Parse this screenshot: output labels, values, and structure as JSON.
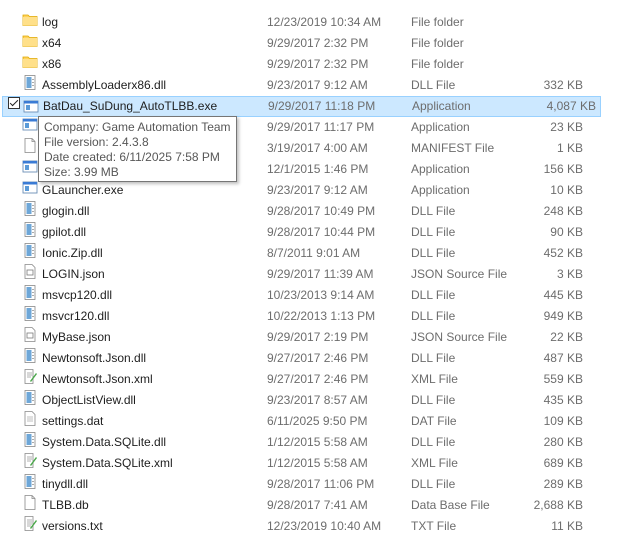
{
  "files": [
    {
      "name": "log",
      "date": "12/23/2019 10:34 AM",
      "type": "File folder",
      "size": "",
      "icon": "folder-icon"
    },
    {
      "name": "x64",
      "date": "9/29/2017 2:32 PM",
      "type": "File folder",
      "size": "",
      "icon": "folder-icon"
    },
    {
      "name": "x86",
      "date": "9/29/2017 2:32 PM",
      "type": "File folder",
      "size": "",
      "icon": "folder-icon"
    },
    {
      "name": "AssemblyLoaderx86.dll",
      "date": "9/23/2017 9:12 AM",
      "type": "DLL File",
      "size": "332 KB",
      "icon": "dll-icon"
    },
    {
      "name": "BatDau_SuDung_AutoTLBB.exe",
      "date": "9/29/2017 11:18 PM",
      "type": "Application",
      "size": "4,087 KB",
      "icon": "exe-icon",
      "selected": true
    },
    {
      "name": "",
      "date": "9/29/2017 11:17 PM",
      "type": "Application",
      "size": "23 KB",
      "icon": "exe-icon"
    },
    {
      "name": "st",
      "date": "3/19/2017 4:00 AM",
      "type": "MANIFEST File",
      "size": "1 KB",
      "icon": "generic-file-icon"
    },
    {
      "name": "",
      "date": "12/1/2015 1:46 PM",
      "type": "Application",
      "size": "156 KB",
      "icon": "exe-icon"
    },
    {
      "name": "GLauncher.exe",
      "date": "9/23/2017 9:12 AM",
      "type": "Application",
      "size": "10 KB",
      "icon": "exe-icon"
    },
    {
      "name": "glogin.dll",
      "date": "9/28/2017 10:49 PM",
      "type": "DLL File",
      "size": "248 KB",
      "icon": "dll-icon"
    },
    {
      "name": "gpilot.dll",
      "date": "9/28/2017 10:44 PM",
      "type": "DLL File",
      "size": "90 KB",
      "icon": "dll-icon"
    },
    {
      "name": "Ionic.Zip.dll",
      "date": "8/7/2011 9:01 AM",
      "type": "DLL File",
      "size": "452 KB",
      "icon": "dll-icon"
    },
    {
      "name": "LOGIN.json",
      "date": "9/29/2017 11:39 AM",
      "type": "JSON Source File",
      "size": "3 KB",
      "icon": "json-icon"
    },
    {
      "name": "msvcp120.dll",
      "date": "10/23/2013 9:14 AM",
      "type": "DLL File",
      "size": "445 KB",
      "icon": "dll-icon"
    },
    {
      "name": "msvcr120.dll",
      "date": "10/22/2013 1:13 PM",
      "type": "DLL File",
      "size": "949 KB",
      "icon": "dll-icon"
    },
    {
      "name": "MyBase.json",
      "date": "9/29/2017 2:19 PM",
      "type": "JSON Source File",
      "size": "22 KB",
      "icon": "json-icon"
    },
    {
      "name": "Newtonsoft.Json.dll",
      "date": "9/27/2017 2:46 PM",
      "type": "DLL File",
      "size": "487 KB",
      "icon": "dll-icon"
    },
    {
      "name": "Newtonsoft.Json.xml",
      "date": "9/27/2017 2:46 PM",
      "type": "XML File",
      "size": "559 KB",
      "icon": "xml-icon"
    },
    {
      "name": "ObjectListView.dll",
      "date": "9/23/2017 8:57 AM",
      "type": "DLL File",
      "size": "435 KB",
      "icon": "dll-icon"
    },
    {
      "name": "settings.dat",
      "date": "6/11/2025 9:50 PM",
      "type": "DAT File",
      "size": "109 KB",
      "icon": "dat-icon"
    },
    {
      "name": "System.Data.SQLite.dll",
      "date": "1/12/2015 5:58 AM",
      "type": "DLL File",
      "size": "280 KB",
      "icon": "dll-icon"
    },
    {
      "name": "System.Data.SQLite.xml",
      "date": "1/12/2015 5:58 AM",
      "type": "XML File",
      "size": "689 KB",
      "icon": "xml-icon"
    },
    {
      "name": "tinydll.dll",
      "date": "9/28/2017 11:06 PM",
      "type": "DLL File",
      "size": "289 KB",
      "icon": "dll-icon"
    },
    {
      "name": "TLBB.db",
      "date": "9/28/2017 7:41 AM",
      "type": "Data Base File",
      "size": "2,688 KB",
      "icon": "db-icon"
    },
    {
      "name": "versions.txt",
      "date": "12/23/2019 10:40 AM",
      "type": "TXT File",
      "size": "11 KB",
      "icon": "txt-icon"
    }
  ],
  "tooltip": {
    "company": "Company: Game Automation Team",
    "version": "File version: 2.4.3.8",
    "created": "Date created: 6/11/2025 7:58 PM",
    "size": "Size: 3.99 MB"
  },
  "colors": {
    "selection_bg": "#cce8ff",
    "selection_border": "#99d1ff",
    "folder": "#ffd35c",
    "secondary_text": "#6d6d6d"
  }
}
